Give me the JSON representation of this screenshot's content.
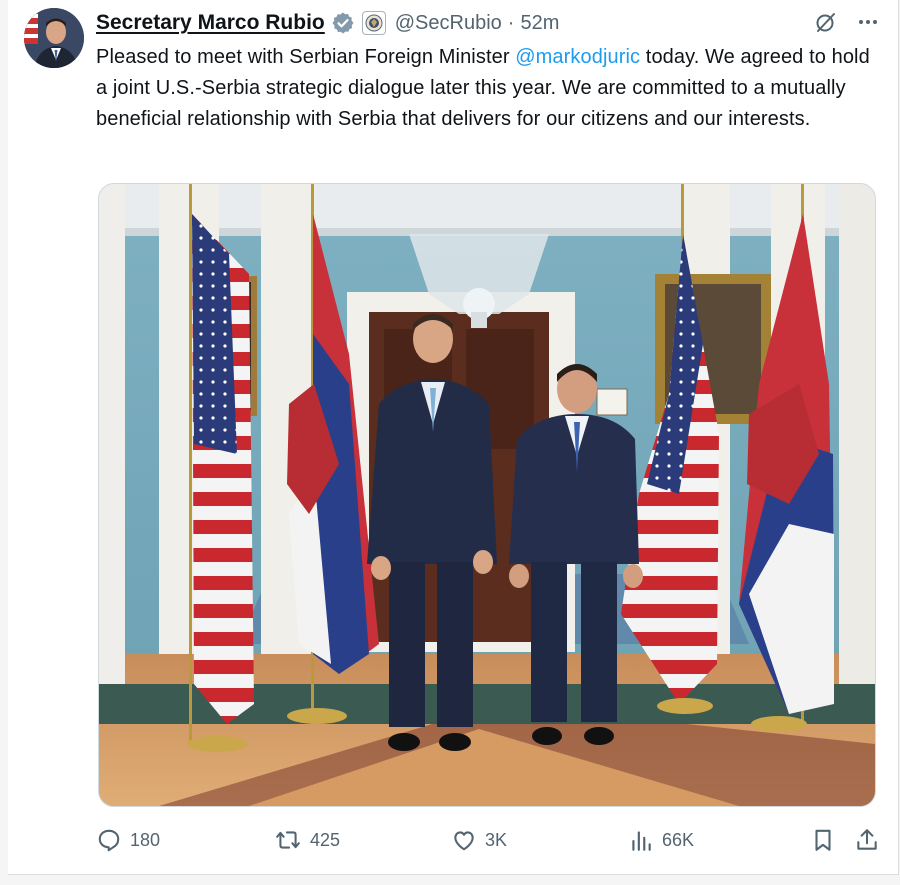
{
  "author": {
    "name": "Secretary Marco Rubio",
    "handle": "@SecRubio",
    "separator": "·",
    "time": "52m"
  },
  "tweet": {
    "text_before": "Pleased to meet with Serbian Foreign Minister ",
    "mention": "@markodjuric",
    "text_after": " today. We agreed to hold a joint U.S.-Serbia strategic dialogue later this year. We are committed to a mutually beneficial relationship with Serbia that delivers for our citizens and our interests."
  },
  "metrics": {
    "replies": "180",
    "reposts": "425",
    "likes": "3K",
    "views": "66K"
  },
  "icons": {
    "verified": "verified-badge-icon",
    "government": "government-seal-icon",
    "grok": "slashed-circle-icon",
    "more": "more-dots-icon",
    "reply": "reply-icon",
    "repost": "repost-icon",
    "like": "heart-icon",
    "views": "views-bar-icon",
    "bookmark": "bookmark-icon",
    "share": "share-icon"
  },
  "colors": {
    "link": "#1d9bf0",
    "secondary_text": "#536471",
    "verified": "#829aab"
  }
}
